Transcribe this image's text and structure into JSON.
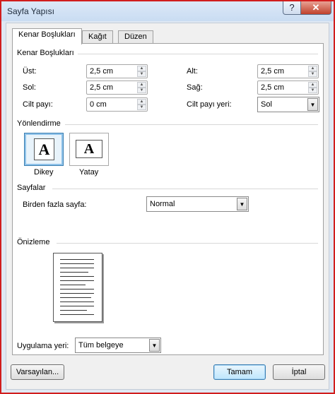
{
  "window": {
    "title": "Sayfa Yapısı",
    "help_glyph": "?",
    "close_glyph": "✕"
  },
  "tabs": [
    {
      "label": "Kenar Boşlukları",
      "active": true
    },
    {
      "label": "Kağıt",
      "active": false
    },
    {
      "label": "Düzen",
      "active": false
    }
  ],
  "margins": {
    "section_label": "Kenar Boşlukları",
    "top_label": "Üst:",
    "top_value": "2,5 cm",
    "bottom_label": "Alt:",
    "bottom_value": "2,5 cm",
    "left_label": "Sol:",
    "left_value": "2,5 cm",
    "right_label": "Sağ:",
    "right_value": "2,5 cm",
    "gutter_label": "Cilt payı:",
    "gutter_value": "0 cm",
    "gutter_pos_label": "Cilt payı yeri:",
    "gutter_pos_value": "Sol"
  },
  "orientation": {
    "section_label": "Yönlendirme",
    "portrait_label": "Dikey",
    "landscape_label": "Yatay",
    "icon_glyph": "A",
    "selected": "portrait"
  },
  "pages": {
    "section_label": "Sayfalar",
    "multiple_label": "Birden fazla sayfa:",
    "multiple_value": "Normal"
  },
  "preview": {
    "section_label": "Önizleme"
  },
  "apply": {
    "label": "Uygulama yeri:",
    "value": "Tüm belgeye"
  },
  "buttons": {
    "default_label": "Varsayılan...",
    "ok_label": "Tamam",
    "cancel_label": "İptal"
  },
  "colors": {
    "frame_border": "#d11d1d",
    "selected_accent": "#3c7fb1"
  }
}
